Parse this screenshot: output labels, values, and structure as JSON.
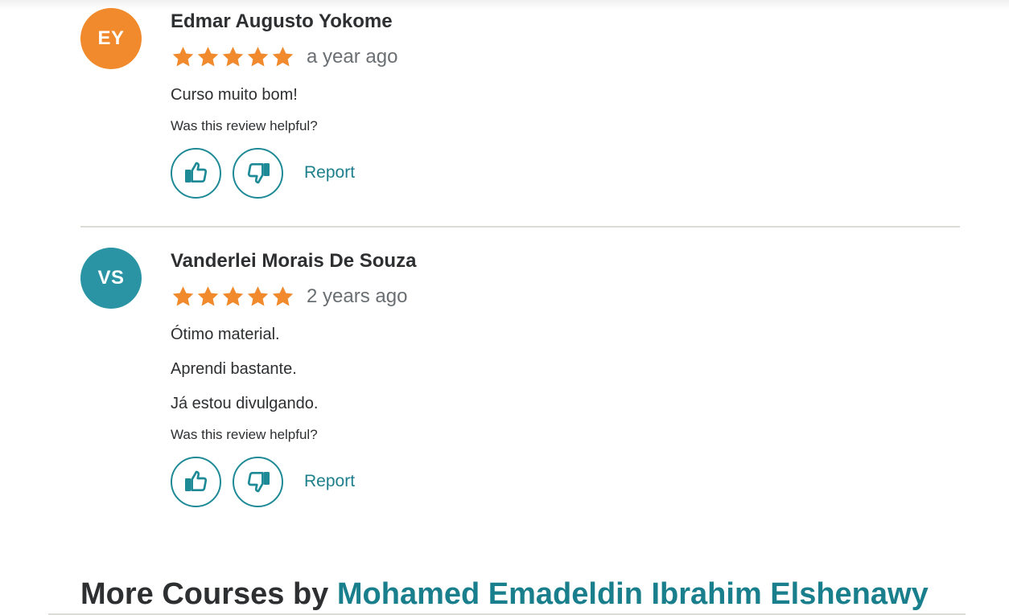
{
  "colors": {
    "accent": "#1e8a96",
    "star": "#f08a2c",
    "avatar_ey": "#f08a2c",
    "avatar_vs": "#2a94a5",
    "divider": "#dcdcd6"
  },
  "reviews": [
    {
      "initials": "EY",
      "name": "Edmar Augusto Yokome",
      "rating": 5,
      "date": "a year ago",
      "comment_lines": [
        "Curso muito bom!"
      ],
      "helpful_prompt": "Was this review helpful?",
      "thumbs_up_icon": "thumbs-up-icon",
      "thumbs_down_icon": "thumbs-down-icon",
      "report_label": "Report"
    },
    {
      "initials": "VS",
      "name": "Vanderlei Morais De Souza",
      "rating": 5,
      "date": "2 years ago",
      "comment_lines": [
        "Ótimo material.",
        "Aprendi bastante.",
        "Já estou divulgando."
      ],
      "helpful_prompt": "Was this review helpful?",
      "thumbs_up_icon": "thumbs-up-icon",
      "thumbs_down_icon": "thumbs-down-icon",
      "report_label": "Report"
    }
  ],
  "more_courses": {
    "prefix": "More Courses by ",
    "instructor": "Mohamed Emadeldin Ibrahim Elshenawy"
  }
}
